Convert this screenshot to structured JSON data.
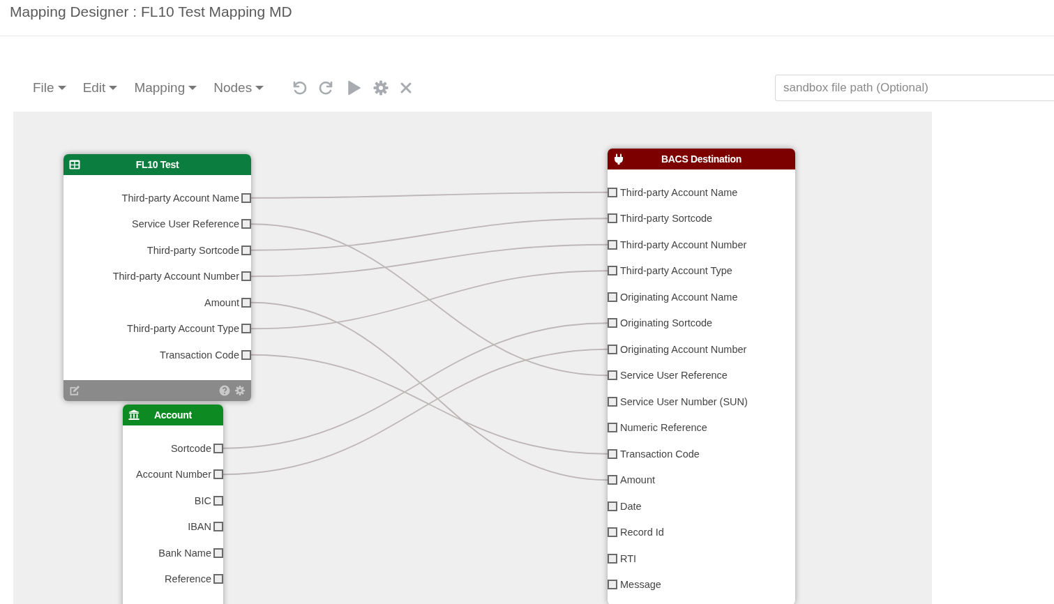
{
  "page": {
    "title": "Mapping Designer : FL10 Test Mapping MD"
  },
  "menus": [
    "File",
    "Edit",
    "Mapping",
    "Nodes"
  ],
  "sandbox_path": {
    "placeholder": "sandbox file path (Optional)"
  },
  "nodes": [
    {
      "title": "FL10 Test",
      "kind": "table",
      "color": "#0b7d3e",
      "fields": [
        "Third-party Account Name",
        "Service User Reference",
        "Third-party Sortcode",
        "Third-party Account Number",
        "Amount",
        "Third-party Account Type",
        "Transaction Code"
      ]
    },
    {
      "title": "Account",
      "kind": "bank",
      "color": "#0d8a22",
      "fields": [
        "Sortcode",
        "Account Number",
        "BIC",
        "IBAN",
        "Bank Name",
        "Reference"
      ]
    },
    {
      "title": "BACS Destination",
      "kind": "destination",
      "color": "#7c0000",
      "fields": [
        "Third-party Account Name",
        "Third-party Sortcode",
        "Third-party Account Number",
        "Third-party Account Type",
        "Originating Account Name",
        "Originating Sortcode",
        "Originating Account Number",
        "Service User Reference",
        "Service User Number (SUN)",
        "Numeric Reference",
        "Transaction Code",
        "Amount",
        "Date",
        "Record Id",
        "RTI",
        "Message"
      ]
    }
  ]
}
